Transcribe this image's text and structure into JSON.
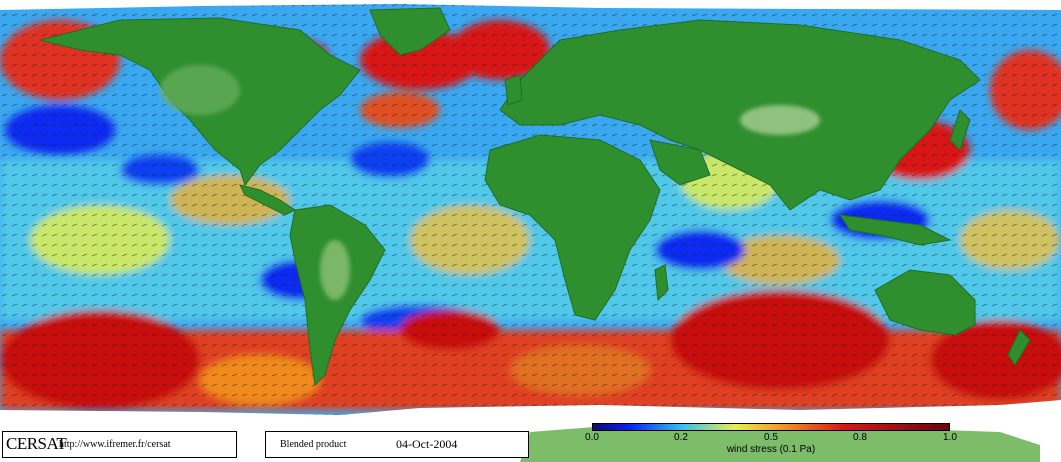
{
  "map": {
    "credit": {
      "brand": "CERSAT",
      "url": "http://www.ifremer.fr/cersat"
    },
    "product": {
      "label": "Blended product",
      "date": "04-Oct-2004"
    },
    "colorbar": {
      "ticks": [
        "0.0",
        "0.2",
        "0.5",
        "0.8",
        "1.0"
      ],
      "tick_values": [
        0.0,
        0.2,
        0.5,
        0.8,
        1.0
      ],
      "label": "wind stress (0.1 Pa)",
      "min": 0.0,
      "max": 1.0
    },
    "colors": {
      "ocean_low": "#0a1ff0",
      "ocean_mid_low": "#2fc0f5",
      "ocean_mid": "#e8f04a",
      "ocean_mid_high": "#f08a1a",
      "ocean_high": "#d81818",
      "ocean_max": "#7a0a0a",
      "land": "#2f8f2f",
      "land_dark": "#1f6f22",
      "land_light": "#8fc07a",
      "ice": "#ffffff"
    }
  }
}
